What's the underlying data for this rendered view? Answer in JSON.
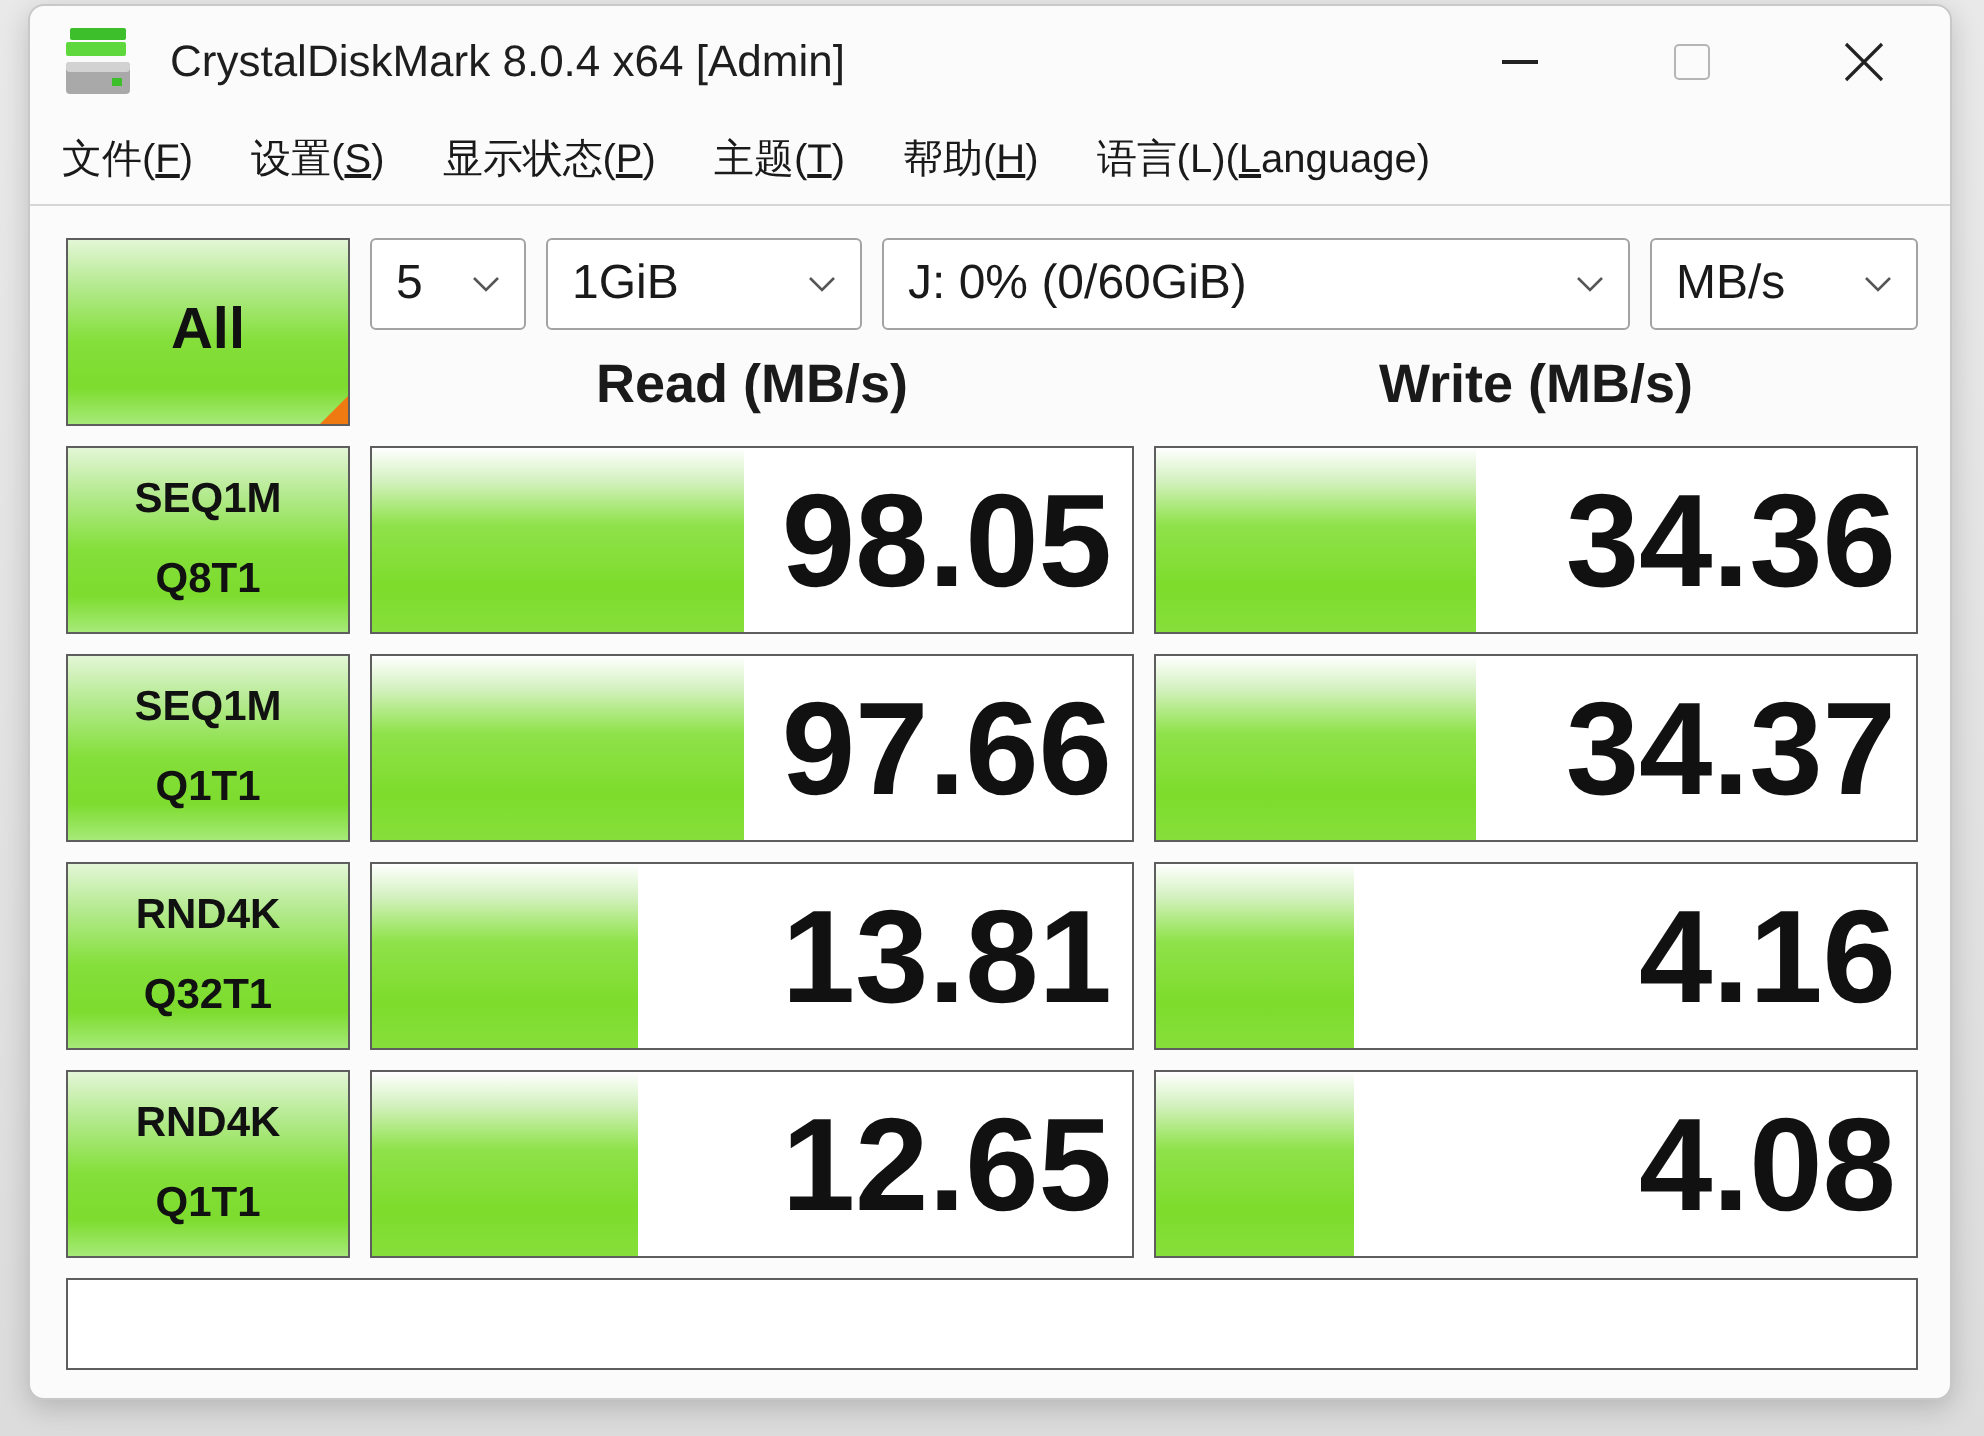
{
  "window": {
    "title": "CrystalDiskMark 8.0.4 x64 [Admin]"
  },
  "menu": [
    {
      "before": "文件(",
      "key": "F",
      "after": ")"
    },
    {
      "before": "设置(",
      "key": "S",
      "after": ")"
    },
    {
      "before": "显示状态(",
      "key": "P",
      "after": ")"
    },
    {
      "before": "主题(",
      "key": "T",
      "after": ")"
    },
    {
      "before": "帮助(",
      "key": "H",
      "after": ")"
    },
    {
      "before": "语言(L)(",
      "key": "L",
      "after": "anguage)"
    }
  ],
  "all_button": {
    "label": "All"
  },
  "dropdowns": [
    {
      "kind": "count",
      "value": "5"
    },
    {
      "kind": "size",
      "value": "1GiB"
    },
    {
      "kind": "drive",
      "value": "J: 0% (0/60GiB)"
    },
    {
      "kind": "unit",
      "value": "MB/s"
    }
  ],
  "columns": {
    "read": "Read (MB/s)",
    "write": "Write (MB/s)"
  },
  "tests": [
    {
      "test": "SEQ1M",
      "params": "Q8T1",
      "read": {
        "value": "98.05",
        "level": 0.49
      },
      "write": {
        "value": "34.36",
        "level": 0.42
      }
    },
    {
      "test": "SEQ1M",
      "params": "Q1T1",
      "read": {
        "value": "97.66",
        "level": 0.49
      },
      "write": {
        "value": "34.37",
        "level": 0.42
      }
    },
    {
      "test": "RND4K",
      "params": "Q32T1",
      "read": {
        "value": "13.81",
        "level": 0.35
      },
      "write": {
        "value": "4.16",
        "level": 0.26
      }
    },
    {
      "test": "RND4K",
      "params": "Q1T1",
      "read": {
        "value": "12.65",
        "level": 0.35
      },
      "write": {
        "value": "4.08",
        "level": 0.26
      }
    }
  ]
}
